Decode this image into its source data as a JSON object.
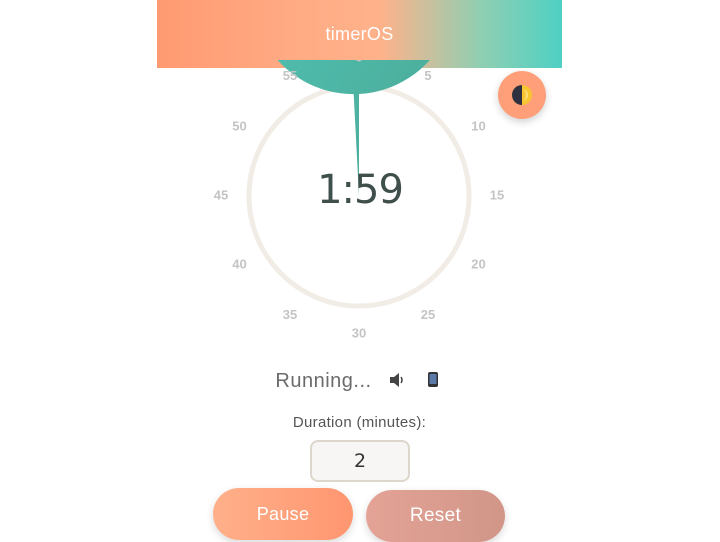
{
  "header": {
    "title": "timerOS"
  },
  "theme_toggle": {
    "icon": "half-moon-icon"
  },
  "dial": {
    "ticks": [
      "0",
      "5",
      "10",
      "15",
      "20",
      "25",
      "30",
      "35",
      "40",
      "45",
      "50",
      "55"
    ],
    "time_remaining": "1:59",
    "remaining_fraction": 0.9917,
    "fill_color": "#4fc3b2",
    "ring_color": "#f1ede6"
  },
  "status": {
    "text": "Running...",
    "sound_icon": "speaker-icon",
    "vibrate_icon": "phone-icon"
  },
  "duration": {
    "label": "Duration (minutes):",
    "value": "2"
  },
  "buttons": {
    "pause_label": "Pause",
    "reset_label": "Reset"
  }
}
